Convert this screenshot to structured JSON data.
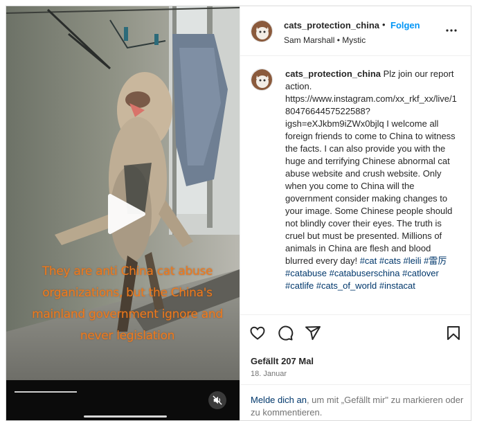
{
  "post": {
    "username": "cats_protection_china",
    "dot": "•",
    "follow_label": "Folgen",
    "subtitle": "Sam Marshall • Mystic",
    "caption_text": "Plz join our report action. https://www.instagram.com/xx_rkf_xx/live/18047664457522588?igsh=eXJkbm9iZWx0bjlq I welcome all foreign friends to come to China to witness the facts. I can also provide you with the huge and terrifying Chinese abnormal cat abuse website and crush website. Only when you come to China will the government consider making changes to your image. Some Chinese people should not blindly cover their eyes. The truth is cruel but must be presented. Millions of animals in China are flesh and blood blurred every day!",
    "hashtags": "#cat #cats #leili #雷厉 #catabuse #catabuserschina #catlover #catlife #cats_of_world #instacat",
    "likes": "Gefällt 207 Mal",
    "date": "18. Januar"
  },
  "video": {
    "overlay_text": "They are anti China cat abuse organizations, but the China's mainland government ignore and never legislation",
    "overlay_color": "#f07a1d"
  },
  "login": {
    "link_label": "Melde dich an",
    "rest_text": ", um mit „Gefällt mir\" zu markieren oder zu kommentieren."
  },
  "icons": {
    "more": "more-icon",
    "like": "heart-icon",
    "comment": "comment-icon",
    "share": "share-icon",
    "save": "bookmark-icon",
    "play": "play-icon",
    "mute": "speaker-muted-icon"
  },
  "colors": {
    "link_blue": "#0095f6",
    "hashtag": "#00376b",
    "muted": "#737373"
  }
}
